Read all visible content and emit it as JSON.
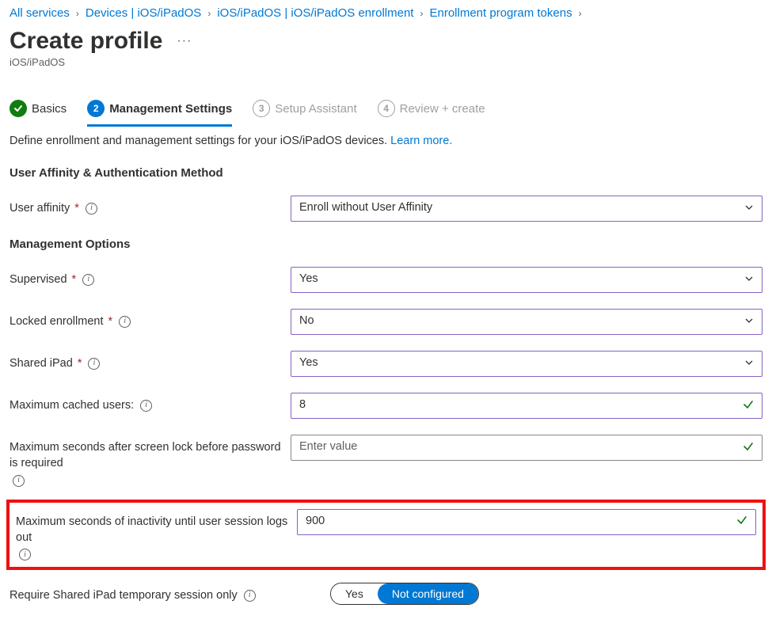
{
  "breadcrumb": [
    {
      "label": "All services"
    },
    {
      "label": "Devices | iOS/iPadOS"
    },
    {
      "label": "iOS/iPadOS | iOS/iPadOS enrollment"
    },
    {
      "label": "Enrollment program tokens"
    }
  ],
  "page": {
    "title": "Create profile",
    "subtitle": "iOS/iPadOS"
  },
  "tabs": {
    "basics": {
      "label": "Basics"
    },
    "mgmt": {
      "num": "2",
      "label": "Management Settings"
    },
    "setup": {
      "num": "3",
      "label": "Setup Assistant"
    },
    "review": {
      "num": "4",
      "label": "Review + create"
    }
  },
  "intro": {
    "text": "Define enrollment and management settings for your iOS/iPadOS devices. ",
    "link": "Learn more."
  },
  "sections": {
    "auth": "User Affinity & Authentication Method",
    "mgmt": "Management Options"
  },
  "fields": {
    "user_affinity": {
      "label": "User affinity",
      "value": "Enroll without User Affinity"
    },
    "supervised": {
      "label": "Supervised",
      "value": "Yes"
    },
    "locked": {
      "label": "Locked enrollment",
      "value": "No"
    },
    "shared_ipad": {
      "label": "Shared iPad",
      "value": "Yes"
    },
    "max_cached": {
      "label": "Maximum cached users:",
      "value": "8"
    },
    "max_lock": {
      "label": "Maximum seconds after screen lock before password is required",
      "placeholder": "Enter value"
    },
    "max_inactive": {
      "label": "Maximum seconds of inactivity until user session logs out",
      "value": "900"
    },
    "temp_session": {
      "label": "Require Shared iPad temporary session only",
      "opts": {
        "yes": "Yes",
        "not_configured": "Not configured"
      }
    }
  }
}
